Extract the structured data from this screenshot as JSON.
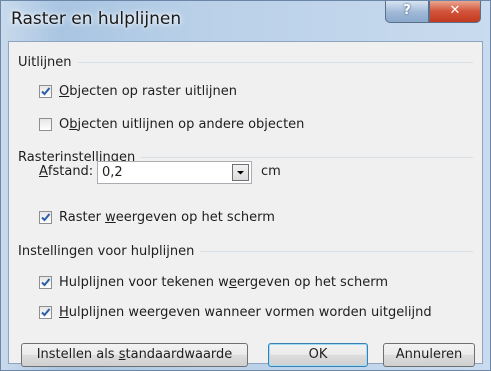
{
  "window": {
    "title": "Raster en hulplijnen",
    "help_label": "?",
    "close_label": "✕"
  },
  "align": {
    "heading": "Uitlijnen",
    "snap_grid": {
      "pre": "",
      "key": "O",
      "post": "bjecten op raster uitlijnen",
      "checked": true
    },
    "snap_objects": {
      "pre": "O",
      "key": "b",
      "post": "jecten uitlijnen op andere objecten",
      "checked": false
    }
  },
  "grid": {
    "heading": "Rasterinstellingen",
    "spacing_pre": "",
    "spacing_key": "A",
    "spacing_post": "fstand:",
    "spacing_value": "0,2",
    "spacing_unit": "cm",
    "show_grid": {
      "pre": "Raster ",
      "key": "w",
      "post": "eergeven op het scherm",
      "checked": true
    }
  },
  "guides": {
    "heading": "Instellingen voor hulplijnen",
    "show_drawing_guides": {
      "pre": "Hulplijnen voor tekenen w",
      "key": "e",
      "post": "ergeven op het scherm",
      "checked": true
    },
    "show_smart_guides": {
      "pre": "",
      "key": "H",
      "post": "ulplijnen weergeven wanneer vormen worden uitgelijnd",
      "checked": true
    }
  },
  "buttons": {
    "set_default_pre": "Instellen als ",
    "set_default_key": "s",
    "set_default_post": "tandaardwaarde",
    "ok": "OK",
    "cancel": "Annuleren"
  }
}
